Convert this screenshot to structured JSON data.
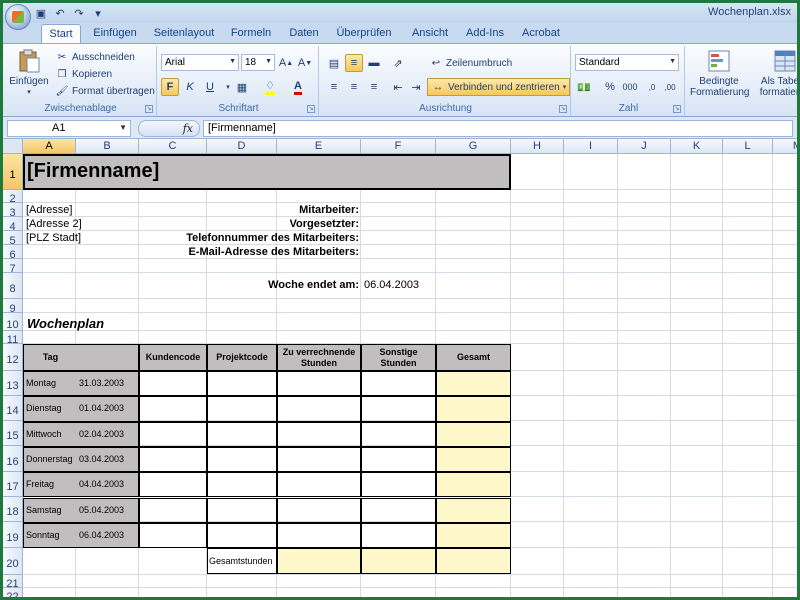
{
  "window": {
    "title": "Wochenplan.xlsx"
  },
  "ribbon_tabs": [
    "Start",
    "Einfügen",
    "Seitenlayout",
    "Formeln",
    "Daten",
    "Überprüfen",
    "Ansicht",
    "Add-Ins",
    "Acrobat"
  ],
  "clipboard": {
    "paste": "Einfügen",
    "cut": "Ausschneiden",
    "copy": "Kopieren",
    "format_painter": "Format übertragen",
    "label": "Zwischenablage"
  },
  "font": {
    "name": "Arial",
    "size": "18",
    "bold": "F",
    "italic": "K",
    "underline": "U",
    "label": "Schriftart"
  },
  "alignment": {
    "wrap": "Zeilenumbruch",
    "merge": "Verbinden und zentrieren",
    "label": "Ausrichtung"
  },
  "number": {
    "format": "Standard",
    "percent": "%",
    "thousands": "000",
    "label": "Zahl"
  },
  "styles": {
    "conditional": "Bedingte Formatierung",
    "as_table": "Als Tabelle formatieren"
  },
  "formula_bar": {
    "name_box": "A1",
    "fx": "fx",
    "content": "[Firmenname]"
  },
  "columns": [
    "A",
    "B",
    "C",
    "D",
    "E",
    "F",
    "G",
    "H",
    "I",
    "J",
    "K",
    "L",
    "M"
  ],
  "rows": [
    "1",
    "2",
    "3",
    "4",
    "5",
    "6",
    "7",
    "8",
    "9",
    "10",
    "11",
    "12",
    "13",
    "14",
    "15",
    "16",
    "17",
    "18",
    "19",
    "20",
    "21",
    "22"
  ],
  "sheet": {
    "company": "[Firmenname]",
    "address1": "[Adresse]",
    "address2": "[Adresse 2]",
    "city": "[PLZ Stadt]",
    "employee_label": "Mitarbeiter:",
    "supervisor_label": "Vorgesetzter:",
    "phone_label": "Telefonnummer des Mitarbeiters:",
    "email_label": "E-Mail-Adresse des Mitarbeiters:",
    "week_end_label": "Woche endet am:",
    "week_end_value": "06.04.2003",
    "section_title": "Wochenplan",
    "headers": [
      "Tag",
      "Kundencode",
      "Projektcode",
      "Zu verrechnende Stunden",
      "Sonstige Stunden",
      "Gesamt"
    ],
    "days": [
      {
        "day": "Montag",
        "date": "31.03.2003"
      },
      {
        "day": "Dienstag",
        "date": "01.04.2003"
      },
      {
        "day": "Mittwoch",
        "date": "02.04.2003"
      },
      {
        "day": "Donnerstag",
        "date": "03.04.2003"
      },
      {
        "day": "Freitag",
        "date": "04.04.2003"
      },
      {
        "day": "Samstag",
        "date": "05.04.2003"
      },
      {
        "day": "Sonntag",
        "date": "06.04.2003"
      }
    ],
    "total_label": "Gesamtstunden"
  }
}
